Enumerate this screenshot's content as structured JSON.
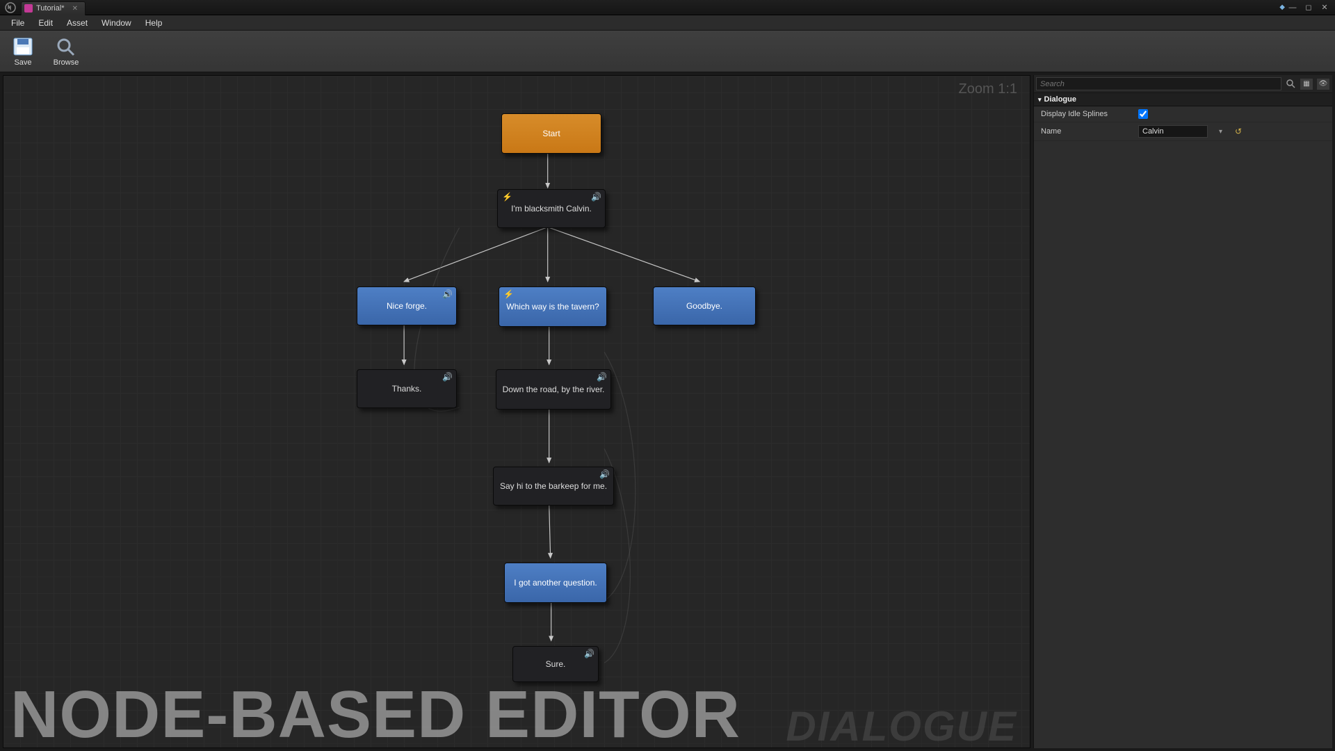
{
  "titlebar": {
    "tab_label": "Tutorial*"
  },
  "menubar": {
    "items": [
      "File",
      "Edit",
      "Asset",
      "Window",
      "Help"
    ]
  },
  "toolbar": {
    "save_label": "Save",
    "browse_label": "Browse"
  },
  "canvas": {
    "zoom_label": "Zoom 1:1",
    "watermark_left": "NODE-BASED EDITOR",
    "watermark_right": "DIALOGUE",
    "nodes": {
      "start": "Start",
      "intro": "I'm blacksmith Calvin.",
      "nice_forge": "Nice forge.",
      "tavern": "Which way is the tavern?",
      "goodbye": "Goodbye.",
      "thanks": "Thanks.",
      "down_road": "Down the road, by the river.",
      "sayhi": "Say hi to the barkeep for me.",
      "another": "I got another question.",
      "sure": "Sure."
    }
  },
  "details": {
    "search_placeholder": "Search",
    "section_title": "Dialogue",
    "display_idle_label": "Display Idle Splines",
    "display_idle_checked": true,
    "name_label": "Name",
    "name_value": "Calvin"
  }
}
